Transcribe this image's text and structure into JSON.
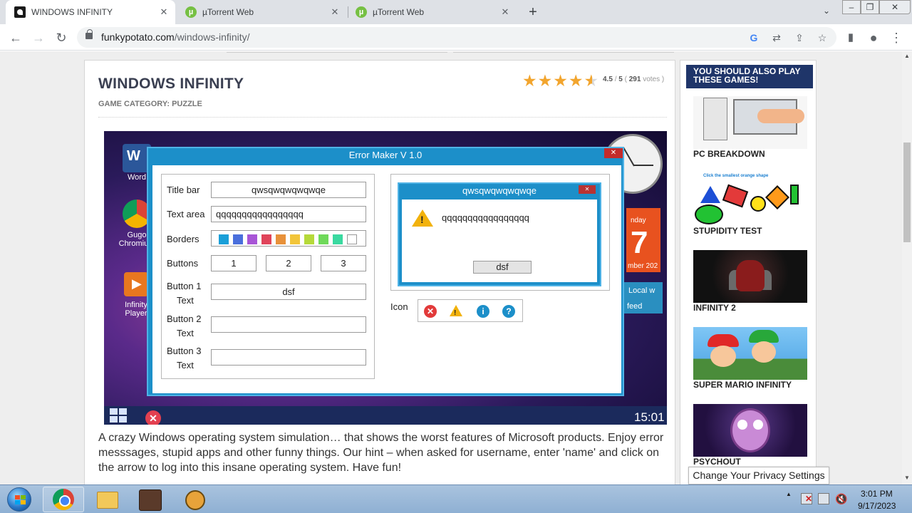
{
  "browser": {
    "tabs": [
      {
        "title": "WINDOWS INFINITY",
        "active": true
      },
      {
        "title": "µTorrent Web",
        "active": false
      },
      {
        "title": "µTorrent Web",
        "active": false
      }
    ],
    "new_tab": "+",
    "url_host": "funkypotato.com",
    "url_path": "/windows-infinity/"
  },
  "game_page": {
    "title": "WINDOWS INFINITY",
    "category_label": "GAME CATEGORY:",
    "category_value": "PUZZLE",
    "rating_score": "4.5",
    "rating_sep": "/",
    "rating_max": "5",
    "rating_votes": "291",
    "rating_votes_label": "votes",
    "rating_stars": 4.5,
    "description": "A crazy Windows operating system simulation… that shows the worst features of Microsoft products. Enjoy error messsages, stupid apps and other funny things. Our hint – when asked for username, enter 'name' and click on the arrow to log into this insane operating system. Have fun!"
  },
  "game_screen": {
    "desktop_icons": [
      {
        "label": "Word"
      },
      {
        "label": "Gugo Chromium"
      },
      {
        "label": "Infinity Player"
      }
    ],
    "calendar_day": "nday",
    "calendar_num": "7",
    "calendar_month": "mber 202",
    "local_tile_line1": "Local w",
    "local_tile_line2": "feed",
    "clock": "15:01",
    "error_maker": {
      "title": "Error Maker V 1.0",
      "labels": {
        "title_bar": "Title bar",
        "text_area": "Text area",
        "borders": "Borders",
        "buttons": "Buttons",
        "button1_text": "Button 1",
        "button2_text": "Button 2",
        "button3_text": "Button 3",
        "text_word": "Text",
        "icon": "Icon"
      },
      "values": {
        "title_bar": "qwsqwqwqwqwqe",
        "text_area": "qqqqqqqqqqqqqqqqq",
        "button_count_1": "1",
        "button_count_2": "2",
        "button_count_3": "3",
        "button1_text": "dsf",
        "button2_text": "",
        "button3_text": ""
      },
      "border_colors": [
        "#1a9fd8",
        "#4a6fdc",
        "#a855d6",
        "#e0445a",
        "#e8913a",
        "#f2c53a",
        "#b5d93a",
        "#6fd95a",
        "#3ad9a0",
        "#ffffff"
      ],
      "preview": {
        "title": "qwsqwqwqwqwqe",
        "text": "qqqqqqqqqqqqqqqqq",
        "button": "dsf"
      }
    }
  },
  "sidebar": {
    "heading": "YOU SHOULD ALSO PLAY THESE GAMES!",
    "games": [
      {
        "name": "PC BREAKDOWN"
      },
      {
        "name": "STUPIDITY TEST"
      },
      {
        "name": "INFINITY 2"
      },
      {
        "name": "SUPER MARIO INFINITY"
      },
      {
        "name": "PSYCHOUT"
      }
    ],
    "stupidity_caption": "Click the smallest orange shape",
    "privacy_button": "Change Your Privacy Settings"
  },
  "taskbar": {
    "time": "3:01 PM",
    "date": "9/17/2023",
    "show_hidden": "▲"
  }
}
